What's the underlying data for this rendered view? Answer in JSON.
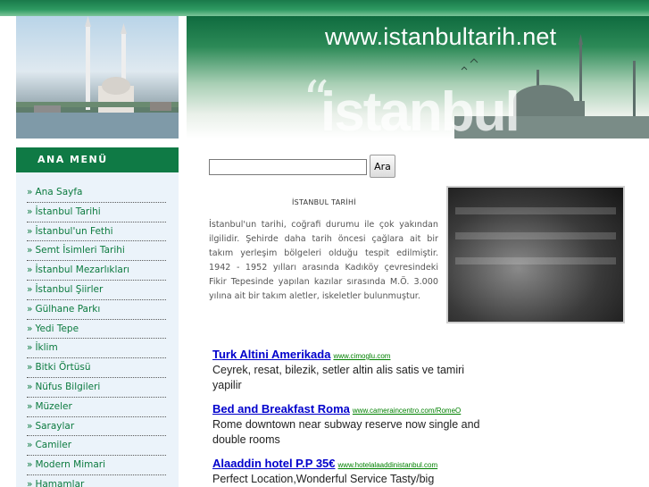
{
  "header": {
    "site_url": "www.istanbultarih.net",
    "logo_text": "istanbul",
    "quote_mark": "“"
  },
  "menu": {
    "title": "ANA MENÜ",
    "items": [
      "Ana Sayfa",
      "İstanbul Tarihi",
      "İstanbul'un Fethi",
      "Semt İsimleri Tarihi",
      "İstanbul Mezarlıkları",
      "İstanbul Şiirler",
      "Gülhane Parkı",
      "Yedi Tepe",
      "İklim",
      "Bitki Örtüsü",
      "Nüfus Bilgileri",
      "Müzeler",
      "Saraylar",
      "Camiler",
      "Modern Mimari",
      "Hamamlar"
    ]
  },
  "search": {
    "value": "",
    "button_label": "Ara"
  },
  "article": {
    "title": "İSTANBUL TARİHİ",
    "body": "İstanbul'un tarihi, coğrafi durumu ile çok yakından ilgilidir. Şehirde daha tarih öncesi çağlara ait bir takım yerleşim bölgeleri olduğu tespit edilmiştir. 1942 - 1952 yılları arasında Kadıköy çevresindeki Fikir Tepesinde yapılan kazılar sırasında M.Ö. 3.000 yılına ait bir takım aletler, iskeletler bulunmuştur."
  },
  "ads": [
    {
      "title": "Turk Altini Amerikada",
      "url": "www.cimoglu.com",
      "text": "Ceyrek, resat, bilezik, setler altin alis satis ve tamiri yapilir"
    },
    {
      "title": "Bed and Breakfast Roma",
      "url": "www.cameraincentro.com/RomeO",
      "text": "Rome downtown near subway reserve now single and double rooms"
    },
    {
      "title": "Alaaddin hotel P.P 35€",
      "url": "www.hotelalaaddinistanbul.com",
      "text": "Perfect Location,Wonderful Service Tasty/big breakfast,Book direct!"
    }
  ],
  "colors": {
    "brand_green": "#0f7a45",
    "menu_bg": "#ebf3fa",
    "ad_link": "#0000cc",
    "ad_url": "#008000"
  }
}
